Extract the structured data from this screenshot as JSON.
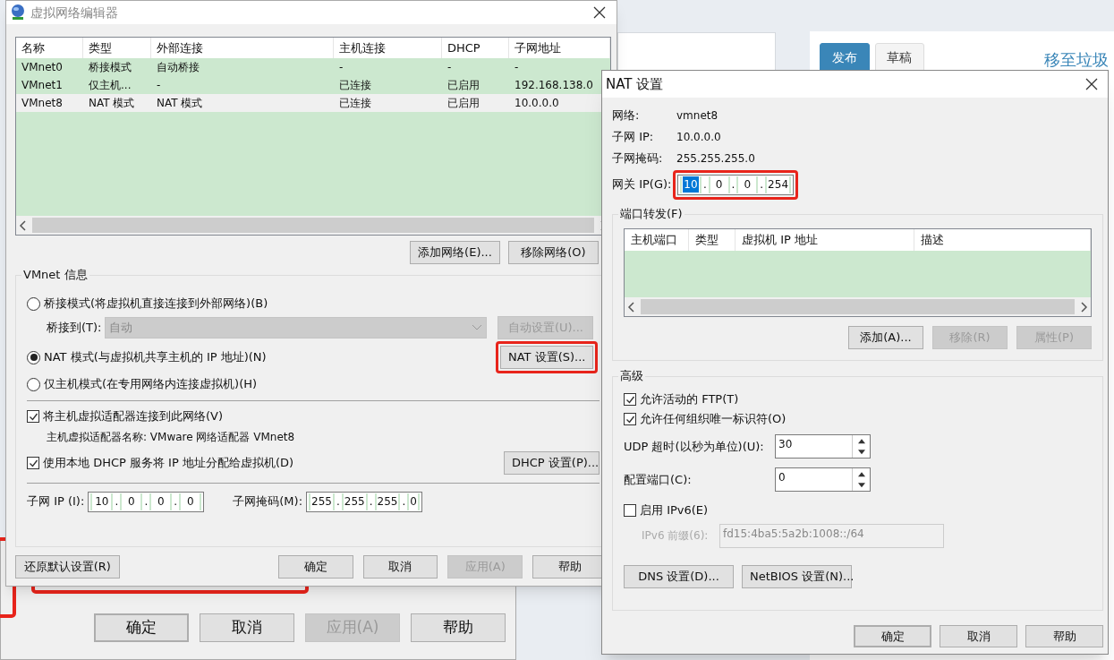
{
  "background_page": {
    "tabs": [
      {
        "label": "发布",
        "selected": true
      },
      {
        "label": "草稿",
        "selected": false
      }
    ],
    "link": "移至垃圾"
  },
  "background_dialog": {
    "buttons": [
      {
        "label": "确定",
        "default": true,
        "disabled": false
      },
      {
        "label": "取消",
        "default": false,
        "disabled": false
      },
      {
        "label": "应用(A)",
        "default": false,
        "disabled": true
      },
      {
        "label": "帮助",
        "default": false,
        "disabled": false
      }
    ]
  },
  "network_editor": {
    "title": "虚拟网络编辑器",
    "table": {
      "columns": [
        "名称",
        "类型",
        "外部连接",
        "主机连接",
        "DHCP",
        "子网地址"
      ],
      "rows": [
        {
          "cells": [
            "VMnet0",
            "桥接模式",
            "自动桥接",
            "-",
            "-",
            "-"
          ],
          "selected": false
        },
        {
          "cells": [
            "VMnet1",
            "仅主机...",
            "-",
            "已连接",
            "已启用",
            "192.168.138.0"
          ],
          "selected": false
        },
        {
          "cells": [
            "VMnet8",
            "NAT 模式",
            "NAT 模式",
            "已连接",
            "已启用",
            "10.0.0.0"
          ],
          "selected": true
        }
      ]
    },
    "table_buttons": [
      {
        "label": "添加网络(E)...",
        "disabled": false
      },
      {
        "label": "移除网络(O)",
        "disabled": false
      }
    ],
    "vmnet_info": {
      "title": "VMnet 信息",
      "modes": [
        {
          "label": "桥接模式(将虚拟机直接连接到外部网络)(B)",
          "selected": false
        },
        {
          "label": "NAT 模式(与虚拟机共享主机的 IP 地址)(N)",
          "selected": true
        },
        {
          "label": "仅主机模式(在专用网络内连接虚拟机)(H)",
          "selected": false
        }
      ],
      "bridge_to": {
        "label": "桥接到(T):",
        "value": "自动",
        "disabled": true
      },
      "auto_button": {
        "label": "自动设置(U)...",
        "disabled": true
      },
      "nat_button": {
        "label": "NAT 设置(S)...",
        "highlighted": true
      },
      "connect_adapter": {
        "label": "将主机虚拟适配器连接到此网络(V)",
        "checked": true
      },
      "adapter_name": "主机虚拟适配器名称: VMware 网络适配器 VMnet8",
      "use_dhcp": {
        "label": "使用本地 DHCP 服务将 IP 地址分配给虚拟机(D)",
        "checked": true
      },
      "dhcp_button": {
        "label": "DHCP 设置(P)..."
      },
      "subnet_ip": {
        "label": "子网 IP (I):",
        "separator": ".",
        "octets": [
          "10",
          "0",
          "0",
          "0"
        ]
      },
      "subnet_mask": {
        "label": "子网掩码(M):",
        "separator": ".",
        "octets": [
          "255",
          "255",
          "255",
          "0"
        ]
      }
    },
    "restore_button": {
      "label": "还原默认设置(R)"
    },
    "footer_buttons": [
      {
        "label": "确定",
        "default": false,
        "disabled": false
      },
      {
        "label": "取消",
        "default": false,
        "disabled": false
      },
      {
        "label": "应用(A)",
        "default": false,
        "disabled": true
      },
      {
        "label": "帮助",
        "default": false,
        "disabled": false
      }
    ]
  },
  "nat_settings": {
    "title": "NAT 设置",
    "info": [
      {
        "label": "网络:",
        "value": "vmnet8"
      },
      {
        "label": "子网 IP:",
        "value": "10.0.0.0"
      },
      {
        "label": "子网掩码:",
        "value": "255.255.255.0"
      }
    ],
    "gateway": {
      "label": "网关 IP(G):",
      "highlighted": true,
      "separator": ".",
      "octets": [
        {
          "value": "10",
          "selected": true
        },
        {
          "value": "0",
          "selected": false
        },
        {
          "value": "0",
          "selected": false
        },
        {
          "value": "254",
          "selected": false
        }
      ]
    },
    "port_forwarding": {
      "title": "端口转发(F)",
      "columns": [
        "主机端口",
        "类型",
        "虚拟机 IP 地址",
        "描述"
      ],
      "buttons": [
        {
          "label": "添加(A)...",
          "disabled": false
        },
        {
          "label": "移除(R)",
          "disabled": true
        },
        {
          "label": "属性(P)",
          "disabled": true
        }
      ]
    },
    "advanced": {
      "title": "高级",
      "checkboxes": [
        {
          "label": "允许活动的 FTP(T)",
          "checked": true
        },
        {
          "label": "允许任何组织唯一标识符(O)",
          "checked": true
        }
      ],
      "spinboxes": [
        {
          "label": "UDP 超时(以秒为单位)(U):",
          "value": "30"
        },
        {
          "label": "配置端口(C):",
          "value": "0"
        }
      ],
      "ipv6": {
        "label": "启用 IPv6(E)",
        "checked": false
      },
      "ipv6_prefix": {
        "label": "IPv6 前缀(6):",
        "value": "fd15:4ba5:5a2b:1008::/64",
        "disabled": true
      },
      "buttons": [
        {
          "label": "DNS 设置(D)..."
        },
        {
          "label": "NetBIOS 设置(N)..."
        }
      ]
    },
    "footer_buttons": [
      {
        "label": "确定",
        "default": true,
        "disabled": false
      },
      {
        "label": "取消",
        "default": false,
        "disabled": false
      },
      {
        "label": "帮助",
        "default": false,
        "disabled": false
      }
    ]
  }
}
